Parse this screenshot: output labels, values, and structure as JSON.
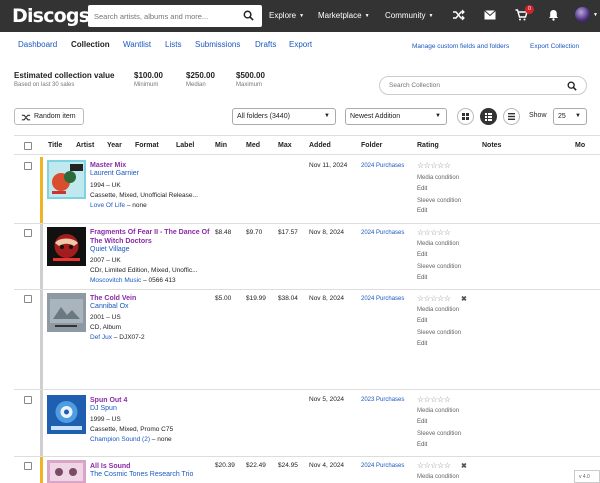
{
  "topbar": {
    "logo": "Discogs",
    "search_placeholder": "Search artists, albums and more...",
    "nav": [
      "Explore",
      "Marketplace",
      "Community"
    ],
    "cart_count": "0"
  },
  "subnav": {
    "tabs": [
      "Dashboard",
      "Collection",
      "Wantlist",
      "Lists",
      "Submissions",
      "Drafts",
      "Export"
    ],
    "active": "Collection",
    "manage": "Manage custom fields and folders",
    "export": "Export Collection"
  },
  "stats": {
    "title": "Estimated collection value",
    "sub": "Based on last 30 sales",
    "items": [
      {
        "value": "$100.00",
        "label": "Minimum"
      },
      {
        "value": "$250.00",
        "label": "Median"
      },
      {
        "value": "$500.00",
        "label": "Maximum"
      }
    ],
    "search_placeholder": "Search Collection"
  },
  "controls": {
    "random": "Random item",
    "folder": "All folders (3440)",
    "sort": "Newest Addition",
    "show_label": "Show",
    "show_value": "25"
  },
  "columns": [
    "Title",
    "Artist",
    "Year",
    "Format",
    "Label",
    "Min",
    "Med",
    "Max",
    "Added",
    "Folder",
    "Rating",
    "Notes",
    "Mo"
  ],
  "labels": {
    "media": "Media condition",
    "sleeve": "Sleeve condition",
    "edit": "Edit",
    "stars": "☆☆☆☆☆",
    "remove": "✖"
  },
  "rows": [
    {
      "title": "Master Mix",
      "artist": "Laurent Garnier",
      "year_country": "1994 – UK",
      "format": "Cassette, Mixed, Unofficial Release...",
      "label": "Love Of Life",
      "catno": " – none",
      "min": "",
      "med": "",
      "max": "",
      "added": "Nov 11, 2024",
      "folder": "2024 Purchases",
      "bar_color": "#f0b323"
    },
    {
      "title": "Fragments Of Fear II - The Dance Of The Witch Doctors",
      "artist": "Quiet Village",
      "year_country": "2007 – UK",
      "format": "CDr, Limited Edition, Mixed, Unoffic...",
      "label": "Moscovitch Music",
      "catno": " – 0566 413",
      "min": "$8.48",
      "med": "$9.70",
      "max": "$17.57",
      "added": "Nov 8, 2024",
      "folder": "2024 Purchases",
      "bar_color": "#cfcfcf"
    },
    {
      "title": "The Cold Vein",
      "artist": "Cannibal Ox",
      "year_country": "2001 – US",
      "format": "CD, Album",
      "label": "Def Jux",
      "catno": " – DJX07-2",
      "min": "$5.00",
      "med": "$19.99",
      "max": "$38.04",
      "added": "Nov 8, 2024",
      "folder": "2024 Purchases",
      "bar_color": "#cfcfcf"
    },
    {
      "title": "Spun Out 4",
      "artist": "DJ Spun",
      "year_country": "1999 – US",
      "format": "Cassette, Mixed, Promo C75",
      "label": "Champion Sound (2)",
      "catno": " – none",
      "min": "",
      "med": "",
      "max": "",
      "added": "Nov 5, 2024",
      "folder": "2023 Purchases",
      "bar_color": "#cfcfcf"
    },
    {
      "title": "All Is Sound",
      "artist": "The Cosmic Tones Research Trio",
      "year_country": "",
      "format": "",
      "label": "",
      "catno": "",
      "min": "$20.39",
      "med": "$22.49",
      "max": "$24.95",
      "added": "Nov 4, 2024",
      "folder": "2024 Purchases",
      "bar_color": "#f0b323"
    }
  ],
  "version": "v 4.0"
}
